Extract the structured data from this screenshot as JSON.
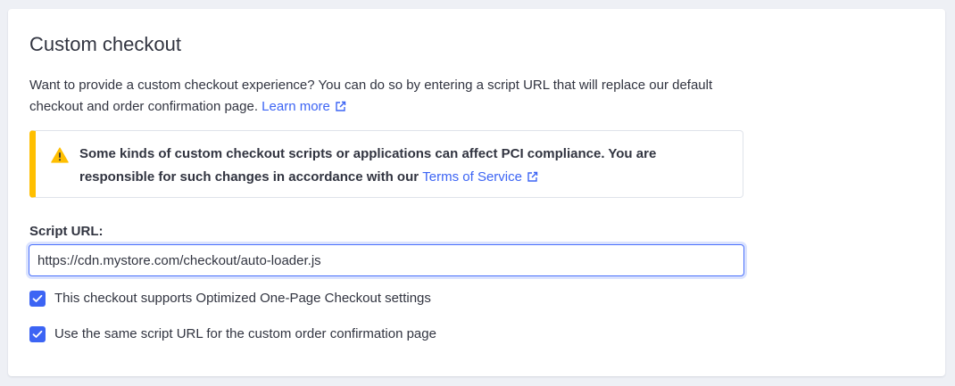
{
  "section": {
    "title": "Custom checkout",
    "description": "Want to provide a custom checkout experience? You can do so by entering a script URL that will replace our default checkout and order confirmation page.",
    "learn_more_label": "Learn more"
  },
  "alert": {
    "message": "Some kinds of custom checkout scripts or applications can affect PCI compliance. You are responsible for such changes in accordance with our",
    "link_label": "Terms of Service",
    "icon": "warning-icon",
    "accent_color": "#ffbf00"
  },
  "script_url": {
    "label": "Script URL:",
    "value": "https://cdn.mystore.com/checkout/auto-loader.js"
  },
  "options": [
    {
      "label": "This checkout supports Optimized One-Page Checkout settings",
      "checked": true
    },
    {
      "label": "Use the same script URL for the custom order confirmation page",
      "checked": true
    }
  ],
  "colors": {
    "link": "#3c64f4",
    "checkbox": "#3c64f4",
    "text": "#313440"
  }
}
